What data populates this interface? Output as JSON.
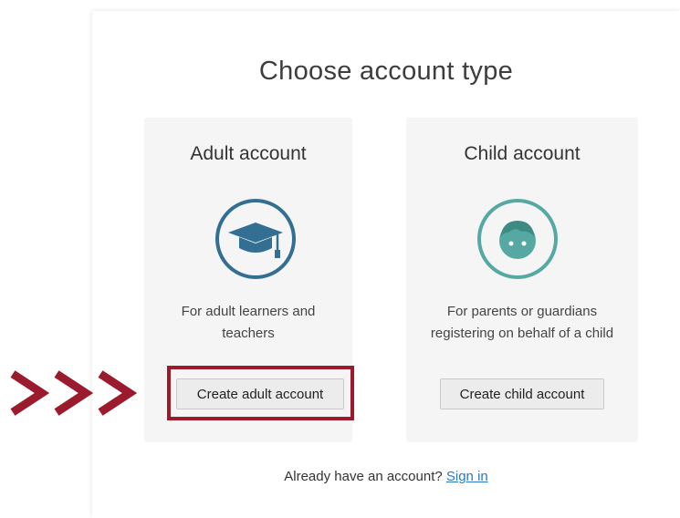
{
  "page": {
    "title": "Choose account type"
  },
  "cards": [
    {
      "title": "Adult account",
      "icon": "graduation-cap-icon",
      "description_line1": "For adult learners and",
      "description_line2": "teachers",
      "button_label": "Create adult account"
    },
    {
      "title": "Child account",
      "icon": "child-face-icon",
      "description_line1": "For parents or guardians",
      "description_line2": "registering on behalf of a child",
      "button_label": "Create child account"
    }
  ],
  "signin": {
    "prompt": "Already have an account? ",
    "link_label": "Sign in"
  },
  "colors": {
    "adult_accent": "#336f93",
    "child_accent": "#56a8a3",
    "highlight": "#9b1b2c",
    "link": "#2a7ac0"
  }
}
